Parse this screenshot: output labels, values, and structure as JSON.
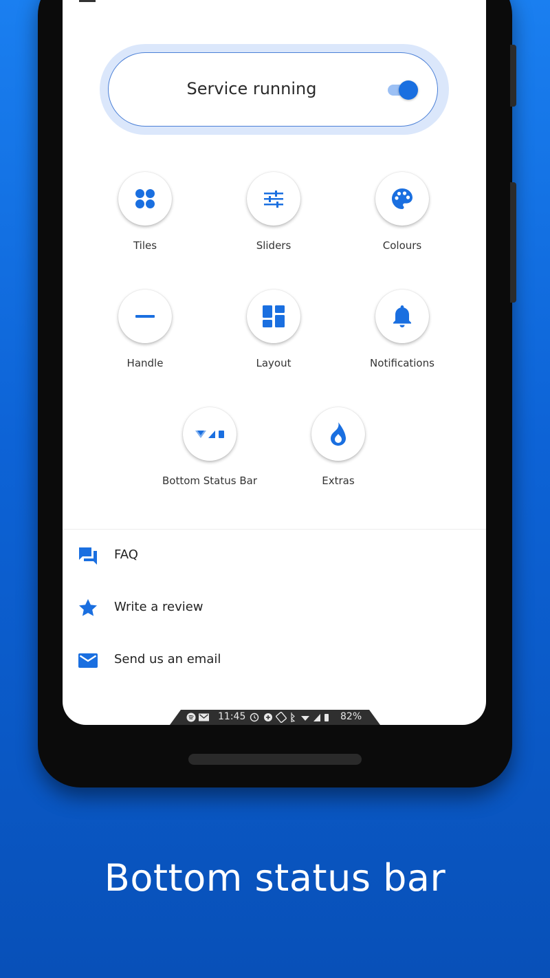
{
  "service": {
    "label": "Service running",
    "enabled": true
  },
  "tiles": [
    {
      "label": "Tiles",
      "icon": "tiles-icon"
    },
    {
      "label": "Sliders",
      "icon": "sliders-icon"
    },
    {
      "label": "Colours",
      "icon": "palette-icon"
    },
    {
      "label": "Handle",
      "icon": "handle-icon"
    },
    {
      "label": "Layout",
      "icon": "layout-icon"
    },
    {
      "label": "Notifications",
      "icon": "bell-icon"
    },
    {
      "label": "Bottom Status Bar",
      "icon": "status-bar-icon"
    },
    {
      "label": "Extras",
      "icon": "flame-icon"
    }
  ],
  "links": [
    {
      "label": "FAQ",
      "icon": "faq-icon"
    },
    {
      "label": "Write a review",
      "icon": "star-icon"
    },
    {
      "label": "Send us an email",
      "icon": "email-icon"
    }
  ],
  "status_bar": {
    "time": "11:45",
    "battery": "82%"
  },
  "caption": "Bottom status bar",
  "colors": {
    "accent": "#1a6fe0",
    "background": "#0d63d6"
  }
}
